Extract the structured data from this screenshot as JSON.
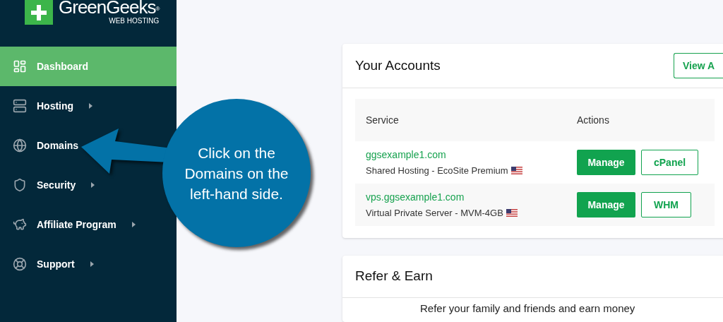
{
  "logo": {
    "name": "GreenGeeks",
    "mark": "®",
    "tagline": "WEB HOSTING"
  },
  "sidebar": {
    "items": [
      {
        "label": "Dashboard",
        "selected": true,
        "has_submenu": false
      },
      {
        "label": "Hosting",
        "selected": false,
        "has_submenu": true
      },
      {
        "label": "Domains",
        "selected": false,
        "has_submenu": false
      },
      {
        "label": "Security",
        "selected": false,
        "has_submenu": true
      },
      {
        "label": "Affiliate Program",
        "selected": false,
        "has_submenu": true
      },
      {
        "label": "Support",
        "selected": false,
        "has_submenu": true
      }
    ]
  },
  "accounts_card": {
    "title": "Your Accounts",
    "view_button": "View A",
    "columns": [
      "Service",
      "Actions"
    ],
    "rows": [
      {
        "domain": "ggsexample1.com",
        "plan": "Shared Hosting - EcoSite Premium",
        "actions": [
          {
            "label": "Manage",
            "kind": "primary"
          },
          {
            "label": "cPanel",
            "kind": "outline"
          }
        ]
      },
      {
        "domain": "vps.ggsexample1.com",
        "plan": "Virtual Private Server - MVM-4GB",
        "actions": [
          {
            "label": "Manage",
            "kind": "primary"
          },
          {
            "label": "WHM",
            "kind": "outline"
          }
        ]
      }
    ]
  },
  "refer_card": {
    "title": "Refer & Earn",
    "text": "Refer your family and friends and earn money"
  },
  "callout": {
    "text": "Click on the Domains on the left-hand side."
  }
}
